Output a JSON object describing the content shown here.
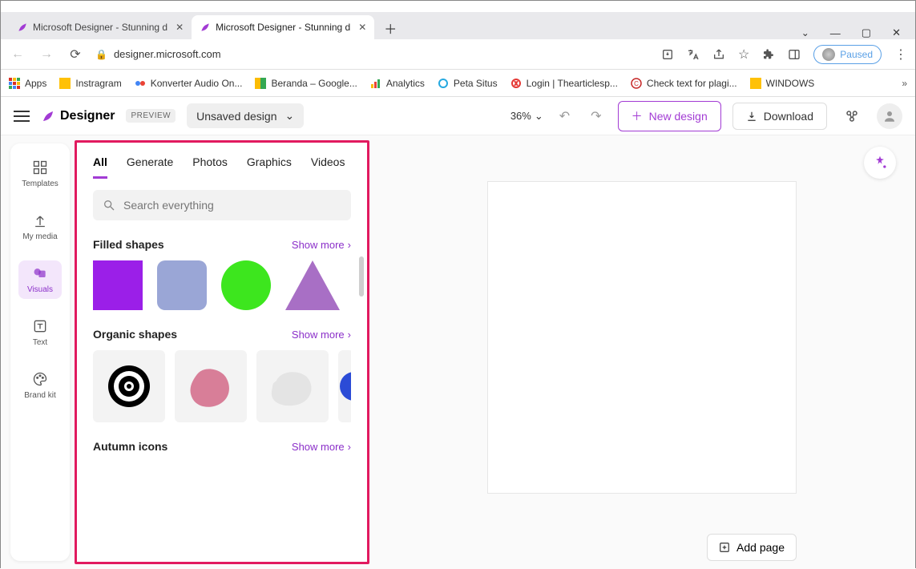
{
  "browser": {
    "tabs": [
      {
        "title": "Microsoft Designer - Stunning d",
        "active": false
      },
      {
        "title": "Microsoft Designer - Stunning d",
        "active": true
      }
    ],
    "url": "designer.microsoft.com",
    "paused_label": "Paused",
    "bookmarks": [
      "Apps",
      "Instragram",
      "Konverter Audio On...",
      "Beranda – Google...",
      "Analytics",
      "Peta Situs",
      "Login | Thearticlesp...",
      "Check text for plagi...",
      "WINDOWS"
    ]
  },
  "app": {
    "brand": "Designer",
    "preview_badge": "PREVIEW",
    "design_name": "Unsaved design",
    "zoom": "36%",
    "new_design": "New design",
    "download": "Download",
    "rail": [
      "Templates",
      "My media",
      "Visuals",
      "Text",
      "Brand kit"
    ],
    "panel_tabs": [
      "All",
      "Generate",
      "Photos",
      "Graphics",
      "Videos"
    ],
    "search_placeholder": "Search everything",
    "sections": {
      "filled": {
        "title": "Filled shapes",
        "more": "Show more"
      },
      "organic": {
        "title": "Organic shapes",
        "more": "Show more"
      },
      "autumn": {
        "title": "Autumn icons",
        "more": "Show more"
      }
    },
    "add_page": "Add page"
  }
}
